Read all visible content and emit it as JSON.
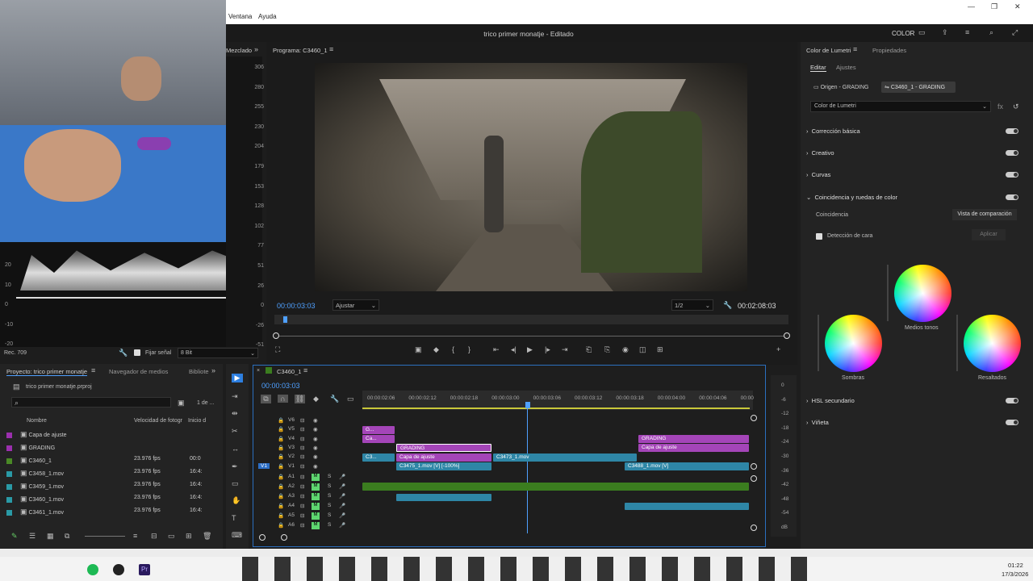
{
  "window": {
    "menu": [
      "Ventana",
      "Ayuda"
    ],
    "title": "trico primer monatje - Editado",
    "workspace": "COLOR"
  },
  "scopes": {
    "header": "Mezclado",
    "labels_right": [
      "306",
      "280",
      "255",
      "230",
      "204",
      "179",
      "153",
      "128",
      "102",
      "77",
      "51",
      "26",
      "0",
      "-26",
      "-51"
    ],
    "labels_left": [
      "20",
      "10",
      "0",
      "-10",
      "-20"
    ],
    "footer_left": "Rec. 709",
    "fix_signal": "Fijar señal",
    "bit_depth": "8 Bit"
  },
  "program": {
    "header": "Programa: C3460_1",
    "timecode": "00:00:03:03",
    "fit": "Ajustar",
    "resolution": "1/2",
    "duration": "00:02:08:03"
  },
  "lumetri": {
    "header": "Color de Lumetri",
    "props_tab": "Propiedades",
    "tab_edit": "Editar",
    "tab_adjust": "Ajustes",
    "source_clip": "Origen - GRADING",
    "target_clip": "C3460_1 - GRADING",
    "effect_select": "Color de Lumetri",
    "sections": [
      "Corrección básica",
      "Creativo",
      "Curvas",
      "Coincidencia y ruedas de color"
    ],
    "match_label": "Coincidencia",
    "compare_button": "Vista de comparación",
    "face_detect": "Detección de cara",
    "apply": "Aplicar",
    "wheels": {
      "mid": "Medios tonos",
      "shadows": "Sombras",
      "highlights": "Resaltados"
    },
    "sections_bottom": [
      "HSL secundario",
      "Viñeta"
    ]
  },
  "project": {
    "tab1": "Proyecto: trico primer monatje",
    "tab2": "Navegador de medios",
    "tab3": "Bibliote",
    "file": "trico primer monatje.prproj",
    "count": "1 de ...",
    "col_name": "Nombre",
    "col_fps": "Velocidad de fotogr",
    "col_start": "Inicio d",
    "items": [
      {
        "name": "Capa de ajuste",
        "fps": "",
        "start": "",
        "color": "#9b2fae"
      },
      {
        "name": "GRADING",
        "fps": "",
        "start": "",
        "color": "#9b2fae"
      },
      {
        "name": "C3460_1",
        "fps": "23.976 fps",
        "start": "00:0",
        "color": "#4a8a26"
      },
      {
        "name": "C3458_1.mov",
        "fps": "23.976 fps",
        "start": "16:4:",
        "color": "#2a9aa6"
      },
      {
        "name": "C3459_1.mov",
        "fps": "23.976 fps",
        "start": "16:4:",
        "color": "#2a9aa6"
      },
      {
        "name": "C3460_1.mov",
        "fps": "23.976 fps",
        "start": "16:4:",
        "color": "#2a9aa6"
      },
      {
        "name": "C3461_1.mov",
        "fps": "23.976 fps",
        "start": "16:4:",
        "color": "#2a9aa6"
      }
    ]
  },
  "timeline": {
    "tab": "C3460_1",
    "timecode": "00:00:03:03",
    "ruler": [
      "00:00:02:06",
      "00:00:02:12",
      "00:00:02:18",
      "00:00:03:00",
      "00:00:03:06",
      "00:00:03:12",
      "00:00:03:18",
      "00:00:04:00",
      "00:00:04:06",
      "00:00"
    ],
    "video_tracks": [
      "V6",
      "V5",
      "V4",
      "V3",
      "V2",
      "V1"
    ],
    "audio_tracks": [
      "A1",
      "A2",
      "A3",
      "A4",
      "A5",
      "A6"
    ],
    "clips": {
      "g_short": "G...",
      "ca_short": "Ca...",
      "grading1": "GRADING",
      "adj1": "Capa de ajuste",
      "c3_short": "C3...",
      "c3475": "C3475_1.mov [V] [-100%]",
      "c3473": "C3473_1.mov",
      "grading2": "GRADING",
      "adj2": "Capa de ajuste",
      "c3488": "C3488_1.mov [V]"
    },
    "db": [
      "0",
      "-6",
      "-12",
      "-18",
      "-24",
      "-30",
      "-36",
      "-42",
      "-48",
      "-54",
      "dB"
    ]
  },
  "taskbar": {
    "time": "01:22",
    "date": "17/3/2026"
  }
}
